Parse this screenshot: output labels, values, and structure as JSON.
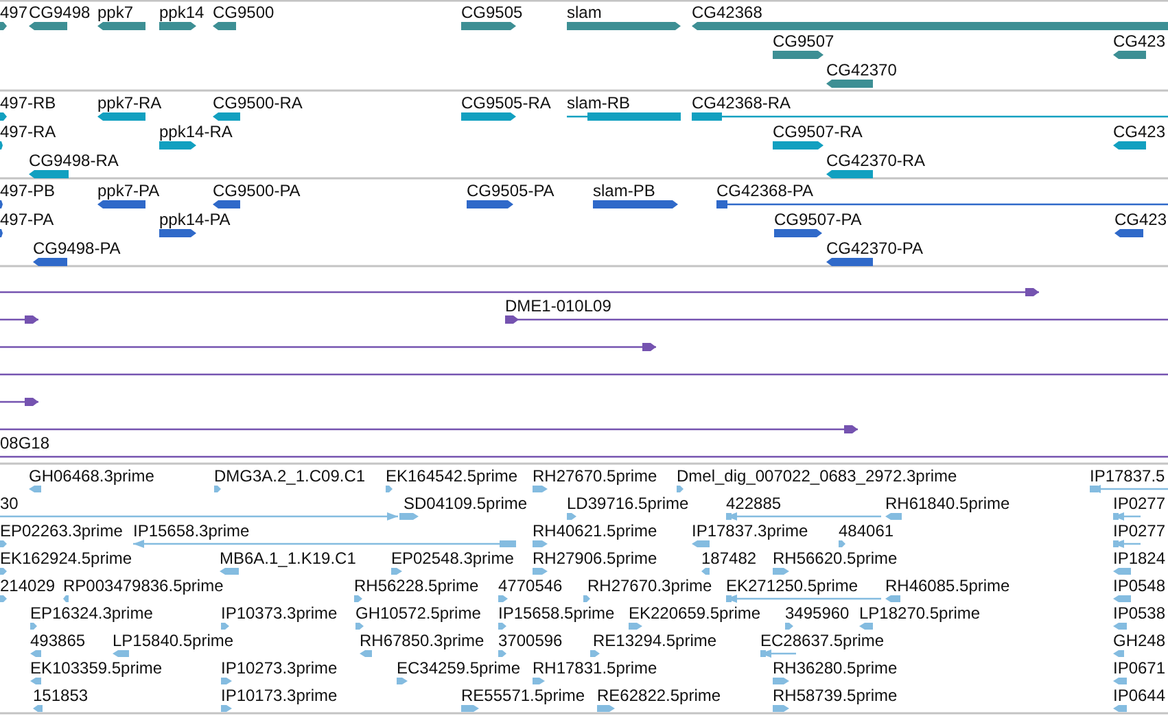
{
  "tracks": [
    {
      "kind": "genes",
      "features": [
        {
          "label": "497",
          "reverse": false
        },
        {
          "label": "CG9498",
          "reverse": true
        },
        {
          "label": "ppk7",
          "reverse": true
        },
        {
          "label": "ppk14",
          "reverse": false
        },
        {
          "label": "CG9500",
          "reverse": true
        },
        {
          "label": "CG9505",
          "reverse": false
        },
        {
          "label": "slam",
          "reverse": false
        },
        {
          "label": "CG42368",
          "reverse": true
        },
        {
          "label": "CG9507",
          "reverse": false
        },
        {
          "label": "CG42370",
          "reverse": true
        },
        {
          "label": "CG423",
          "reverse": true
        }
      ]
    },
    {
      "kind": "transcripts",
      "features": [
        {
          "label": "497-RB",
          "reverse": false
        },
        {
          "label": "497-RA",
          "reverse": false
        },
        {
          "label": "ppk7-RA",
          "reverse": true
        },
        {
          "label": "CG9500-RA",
          "reverse": true
        },
        {
          "label": "ppk14-RA",
          "reverse": false
        },
        {
          "label": "CG9498-RA",
          "reverse": true
        },
        {
          "label": "CG9505-RA",
          "reverse": false
        },
        {
          "label": "slam-RB",
          "reverse": false
        },
        {
          "label": "CG42368-RA",
          "reverse": true
        },
        {
          "label": "CG9507-RA",
          "reverse": false
        },
        {
          "label": "CG42370-RA",
          "reverse": true
        },
        {
          "label": "CG423",
          "reverse": true
        }
      ]
    },
    {
      "kind": "proteins",
      "features": [
        {
          "label": "497-PB",
          "reverse": false
        },
        {
          "label": "497-PA",
          "reverse": false
        },
        {
          "label": "ppk7-PA",
          "reverse": true
        },
        {
          "label": "CG9500-PA",
          "reverse": true
        },
        {
          "label": "ppk14-PA",
          "reverse": false
        },
        {
          "label": "CG9498-PA",
          "reverse": true
        },
        {
          "label": "CG9505-PA",
          "reverse": false
        },
        {
          "label": "slam-PB",
          "reverse": false
        },
        {
          "label": "CG42368-PA",
          "reverse": true
        },
        {
          "label": "CG9507-PA",
          "reverse": false
        },
        {
          "label": "CG42370-PA",
          "reverse": true
        },
        {
          "label": "CG423",
          "reverse": true
        }
      ]
    },
    {
      "kind": "alignments",
      "features": [
        {
          "kind": "arrow",
          "reverse": false
        },
        {
          "kind": "arrow",
          "reverse": false
        },
        {
          "kind": "arrow",
          "label": "DME1-010L09",
          "reverse": true
        },
        {
          "kind": "arrow",
          "reverse": false
        },
        {
          "kind": "span"
        },
        {
          "kind": "arrow",
          "reverse": false
        },
        {
          "kind": "arrow",
          "reverse": false
        },
        {
          "kind": "span",
          "label": "08G18"
        }
      ]
    },
    {
      "kind": "ests",
      "features": [
        {
          "label": "GH06468.3prime",
          "reverse": true
        },
        {
          "label": "DMG3A.2_1.C09.C1",
          "reverse": false
        },
        {
          "label": "EK164542.5prime",
          "reverse": false
        },
        {
          "label": "RH27670.5prime",
          "reverse": false
        },
        {
          "label": "Dmel_dig_007022_0683_2972.3prime",
          "reverse": false
        },
        {
          "label": "IP17837.5",
          "reverse": true
        },
        {
          "label": "30",
          "reverse": false
        },
        {
          "label": "SD04109.5prime",
          "reverse": false
        },
        {
          "label": "LD39716.5prime",
          "reverse": false
        },
        {
          "label": "422885",
          "reverse": true
        },
        {
          "label": "RH61840.5prime",
          "reverse": true
        },
        {
          "label": "IP0277",
          "reverse": true
        },
        {
          "label": "EP02263.3prime",
          "reverse": false
        },
        {
          "label": "IP15658.3prime",
          "reverse": true
        },
        {
          "label": "RH40621.5prime",
          "reverse": false
        },
        {
          "label": "IP17837.3prime",
          "reverse": true
        },
        {
          "label": "484061",
          "reverse": false
        },
        {
          "label": "IP0277",
          "reverse": true
        },
        {
          "label": "EK162924.5prime",
          "reverse": false
        },
        {
          "label": "MB6A.1_1.K19.C1",
          "reverse": true
        },
        {
          "label": "EP02548.3prime",
          "reverse": false
        },
        {
          "label": "RH27906.5prime",
          "reverse": false
        },
        {
          "label": "187482",
          "reverse": true
        },
        {
          "label": "RH56620.5prime",
          "reverse": false
        },
        {
          "label": "IP1824",
          "reverse": true
        },
        {
          "label": "214029",
          "reverse": false
        },
        {
          "label": "RP003479836.5prime",
          "reverse": true
        },
        {
          "label": "RH56228.5prime",
          "reverse": false
        },
        {
          "label": "4770546",
          "reverse": false
        },
        {
          "label": "RH27670.3prime",
          "reverse": false
        },
        {
          "label": "EK271250.5prime",
          "reverse": true
        },
        {
          "label": "RH46085.5prime",
          "reverse": true
        },
        {
          "label": "IP0548",
          "reverse": true
        },
        {
          "label": "EP16324.3prime",
          "reverse": false
        },
        {
          "label": "IP10373.3prime",
          "reverse": false
        },
        {
          "label": "GH10572.5prime",
          "reverse": false
        },
        {
          "label": "IP15658.5prime",
          "reverse": false
        },
        {
          "label": "EK220659.5prime",
          "reverse": false
        },
        {
          "label": "3495960",
          "reverse": false
        },
        {
          "label": "LP18270.5prime",
          "reverse": true
        },
        {
          "label": "IP0538",
          "reverse": true
        },
        {
          "label": "493865",
          "reverse": true
        },
        {
          "label": "LP15840.5prime",
          "reverse": true
        },
        {
          "label": "RH67850.3prime",
          "reverse": true
        },
        {
          "label": "3700596",
          "reverse": false
        },
        {
          "label": "RE13294.5prime",
          "reverse": false
        },
        {
          "label": "EC28637.5prime",
          "reverse": true
        },
        {
          "label": "GH248",
          "reverse": true
        },
        {
          "label": "EK103359.5prime",
          "reverse": true
        },
        {
          "label": "IP10273.3prime",
          "reverse": false
        },
        {
          "label": "EC34259.5prime",
          "reverse": false
        },
        {
          "label": "RH17831.5prime",
          "reverse": false
        },
        {
          "label": "RH36280.5prime",
          "reverse": false
        },
        {
          "label": "IP0671",
          "reverse": true
        },
        {
          "label": "151853",
          "reverse": true
        },
        {
          "label": "IP10173.3prime",
          "reverse": false
        },
        {
          "label": "RE55571.5prime",
          "reverse": false
        },
        {
          "label": "RE62822.5prime",
          "reverse": false
        },
        {
          "label": "RH58739.5prime",
          "reverse": false
        },
        {
          "label": "IP0644",
          "reverse": true
        }
      ]
    }
  ]
}
